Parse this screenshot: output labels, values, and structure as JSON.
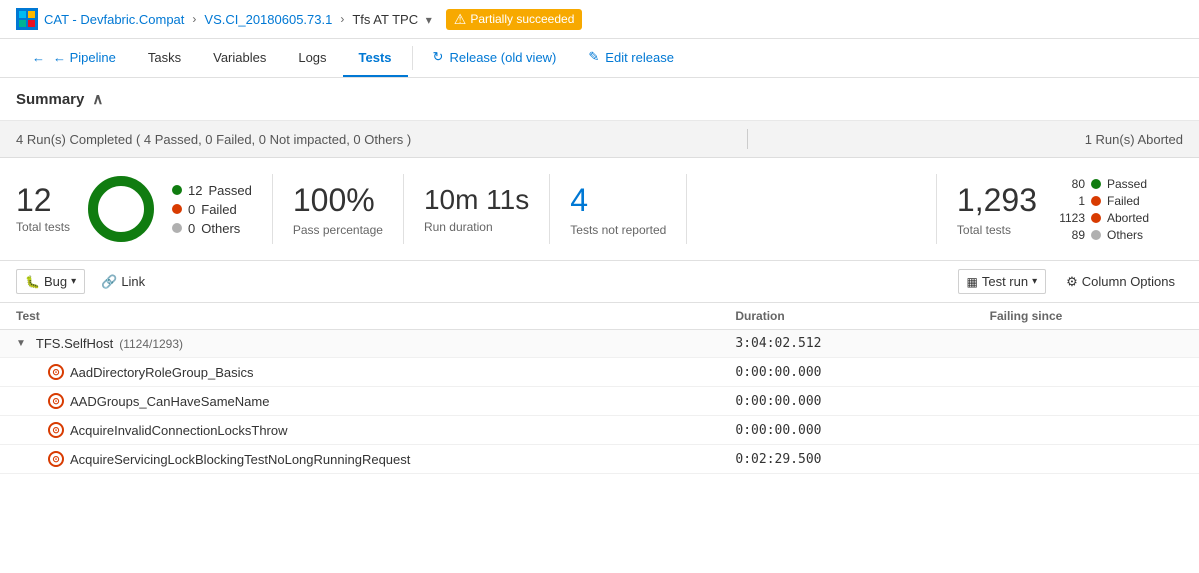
{
  "app": {
    "brand_icon": "AZ",
    "breadcrumb": [
      {
        "label": "CAT - Devfabric.Compat",
        "active": false
      },
      {
        "label": "VS.CI_20180605.73.1",
        "active": false
      },
      {
        "label": "Tfs AT TPC",
        "active": true
      },
      {
        "label": "Partially succeeded",
        "status": "warning"
      }
    ]
  },
  "nav": {
    "back_label": "← Pipeline",
    "items": [
      {
        "label": "Tasks",
        "active": false
      },
      {
        "label": "Variables",
        "active": false
      },
      {
        "label": "Logs",
        "active": false
      },
      {
        "label": "Tests",
        "active": true
      }
    ],
    "actions": [
      {
        "label": "Release (old view)",
        "icon": "refresh"
      },
      {
        "label": "Edit release",
        "icon": "edit"
      }
    ]
  },
  "summary": {
    "title": "Summary",
    "completed_banner": "4 Run(s) Completed ( 4 Passed, 0 Failed, 0 Not impacted, 0 Others )",
    "aborted_banner": "1 Run(s) Aborted",
    "left": {
      "total_tests": 12,
      "total_tests_label": "Total tests",
      "donut": {
        "passed": 12,
        "failed": 0,
        "others": 0,
        "passed_color": "#107c10",
        "failed_color": "#d83b01",
        "others_color": "#b0b0b0"
      },
      "legend": [
        {
          "label": "Passed",
          "value": 12,
          "color": "#107c10"
        },
        {
          "label": "Failed",
          "value": 0,
          "color": "#d83b01"
        },
        {
          "label": "Others",
          "value": 0,
          "color": "#b0b0b0"
        }
      ],
      "pass_pct": "100%",
      "pass_pct_label": "Pass percentage",
      "duration": "10m 11s",
      "duration_label": "Run duration",
      "unreported": 4,
      "unreported_label": "Tests not reported"
    },
    "right": {
      "total_tests": "1,293",
      "total_tests_label": "Total tests",
      "legend": [
        {
          "label": "Passed",
          "value": "80",
          "color": "#107c10"
        },
        {
          "label": "Failed",
          "value": "1",
          "color": "#d83b01"
        },
        {
          "label": "Aborted",
          "value": "1123",
          "color": "#d83b01"
        },
        {
          "label": "Others",
          "value": "89",
          "color": "#b0b0b0"
        }
      ]
    }
  },
  "toolbar": {
    "bug_label": "Bug",
    "link_label": "Link",
    "test_run_label": "Test run",
    "column_options_label": "Column Options"
  },
  "table": {
    "columns": [
      "Test",
      "Duration",
      "Failing since"
    ],
    "group": {
      "name": "TFS.SelfHost",
      "sub": "(1124/1293)",
      "duration": "3:04:02.512"
    },
    "rows": [
      {
        "name": "AadDirectoryRoleGroup_Basics",
        "duration": "0:00:00.000"
      },
      {
        "name": "AADGroups_CanHaveSameName",
        "duration": "0:00:00.000"
      },
      {
        "name": "AcquireInvalidConnectionLocksThrow",
        "duration": "0:00:00.000"
      },
      {
        "name": "AcquireServicingLockBlockingTestNoLongRunningRequest",
        "duration": "0:02:29.500"
      }
    ]
  }
}
